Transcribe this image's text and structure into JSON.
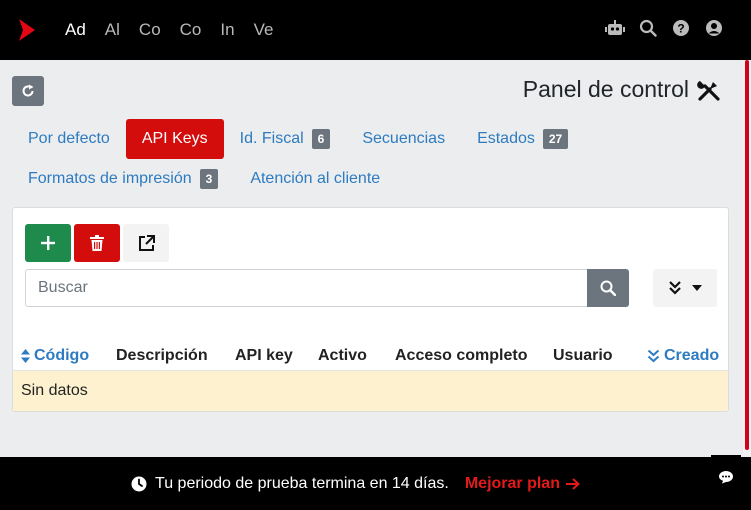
{
  "nav": {
    "items": [
      "Ad",
      "Al",
      "Co",
      "Co",
      "In",
      "Ve"
    ],
    "active_index": 0
  },
  "header": {
    "title": "Panel de control"
  },
  "tabs": [
    {
      "label": "Por defecto",
      "badge": null,
      "active": false
    },
    {
      "label": "API Keys",
      "badge": null,
      "active": true
    },
    {
      "label": "Id. Fiscal",
      "badge": "6",
      "active": false
    },
    {
      "label": "Secuencias",
      "badge": null,
      "active": false
    },
    {
      "label": "Estados",
      "badge": "27",
      "active": false
    },
    {
      "label": "Formatos de impresión",
      "badge": "3",
      "active": false
    },
    {
      "label": "Atención al cliente",
      "badge": null,
      "active": false
    }
  ],
  "search": {
    "placeholder": "Buscar",
    "value": ""
  },
  "table": {
    "columns": [
      "Código",
      "Descripción",
      "API key",
      "Activo",
      "Acceso completo",
      "Usuario",
      "Creado"
    ],
    "empty_text": "Sin datos"
  },
  "trial": {
    "message": "Tu periodo de prueba termina en 14 días.",
    "upgrade_label": "Mejorar plan"
  },
  "colors": {
    "brand_red": "#d30c0c",
    "link_blue": "#2d7bc0",
    "success_green": "#1e8a4c",
    "secondary_gray": "#6c757d",
    "empty_row": "#fdf1cf"
  }
}
